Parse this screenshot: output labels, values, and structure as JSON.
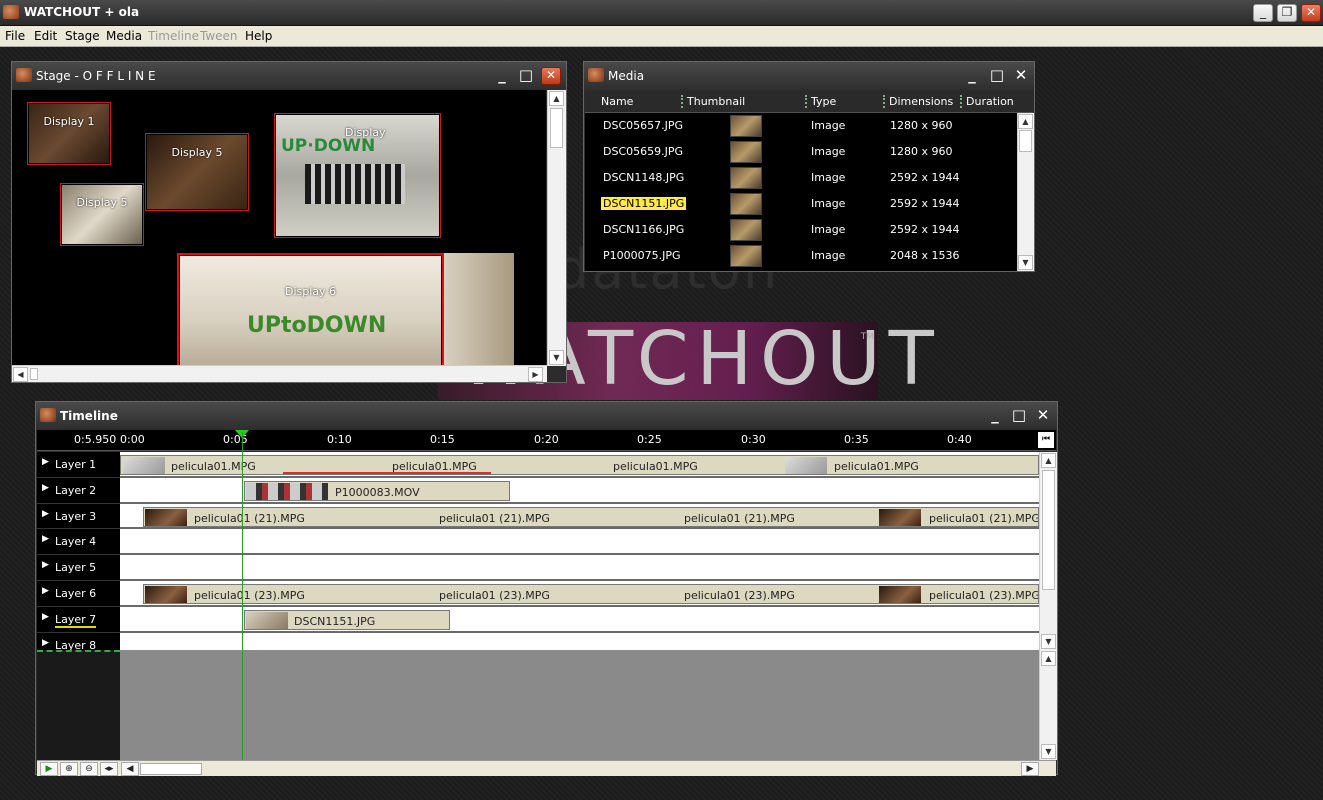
{
  "app": {
    "title": "WATCHOUT + ola",
    "minimize": "_",
    "restore": "❐",
    "close": "✕"
  },
  "menu": {
    "items": [
      {
        "label": "File",
        "enabled": true
      },
      {
        "label": "Edit",
        "enabled": true
      },
      {
        "label": "Stage",
        "enabled": true
      },
      {
        "label": "Media",
        "enabled": true
      },
      {
        "label": "Timeline",
        "enabled": false
      },
      {
        "label": "Tween",
        "enabled": false
      },
      {
        "label": "Help",
        "enabled": true
      }
    ]
  },
  "background": {
    "brand": "WATCHOUT",
    "trademark": "TM",
    "company": "dataton"
  },
  "stage": {
    "title": "Stage - O F F  L I N E",
    "displays": [
      {
        "label": "Display 1"
      },
      {
        "label": "Display 5"
      },
      {
        "label": "Display"
      },
      {
        "label": "Display 5"
      },
      {
        "label": "Display 6"
      }
    ],
    "banner_text": "UPtoDOWN"
  },
  "media": {
    "title": "Media",
    "columns": [
      "Name",
      "Thumbnail",
      "Type",
      "Dimensions",
      "Duration"
    ],
    "rows": [
      {
        "name": "DSC05657.JPG",
        "type": "Image",
        "dimensions": "1280 x 960",
        "duration": "",
        "selected": false
      },
      {
        "name": "DSC05659.JPG",
        "type": "Image",
        "dimensions": "1280 x 960",
        "duration": "",
        "selected": false
      },
      {
        "name": "DSCN1148.JPG",
        "type": "Image",
        "dimensions": "2592 x 1944",
        "duration": "",
        "selected": false
      },
      {
        "name": "DSCN1151.JPG",
        "type": "Image",
        "dimensions": "2592 x 1944",
        "duration": "",
        "selected": true
      },
      {
        "name": "DSCN1166.JPG",
        "type": "Image",
        "dimensions": "2592 x 1944",
        "duration": "",
        "selected": false
      },
      {
        "name": "P1000075.JPG",
        "type": "Image",
        "dimensions": "2048 x 1536",
        "duration": "",
        "selected": false
      }
    ]
  },
  "timeline": {
    "title": "Timeline",
    "current_time": "0:5.950",
    "ticks": [
      "0:00",
      "0:05",
      "0:10",
      "0:15",
      "0:20",
      "0:25",
      "0:30",
      "0:35",
      "0:40"
    ],
    "layers": [
      "Layer 1",
      "Layer 2",
      "Layer 3",
      "Layer 4",
      "Layer 5",
      "Layer 6",
      "Layer 7",
      "Layer 8"
    ],
    "cues": {
      "layer1": [
        "pelicula01.MPG",
        "pelicula01.MPG",
        "pelicula01.MPG",
        "pelicula01.MPG"
      ],
      "layer2": "P1000083.MOV",
      "layer3": [
        "pelicula01 (21).MPG",
        "pelicula01 (21).MPG",
        "pelicula01 (21).MPG",
        "pelicula01 (21).MPG"
      ],
      "layer6": [
        "pelicula01 (23).MPG",
        "pelicula01 (23).MPG",
        "pelicula01 (23).MPG",
        "pelicula01 (23).MPG"
      ],
      "layer7": "DSCN1151.JPG"
    }
  },
  "icons": {
    "play": "play-icon",
    "zoom_in": "zoom-in-icon",
    "zoom_out": "zoom-out-icon",
    "fit": "fit-icon"
  }
}
